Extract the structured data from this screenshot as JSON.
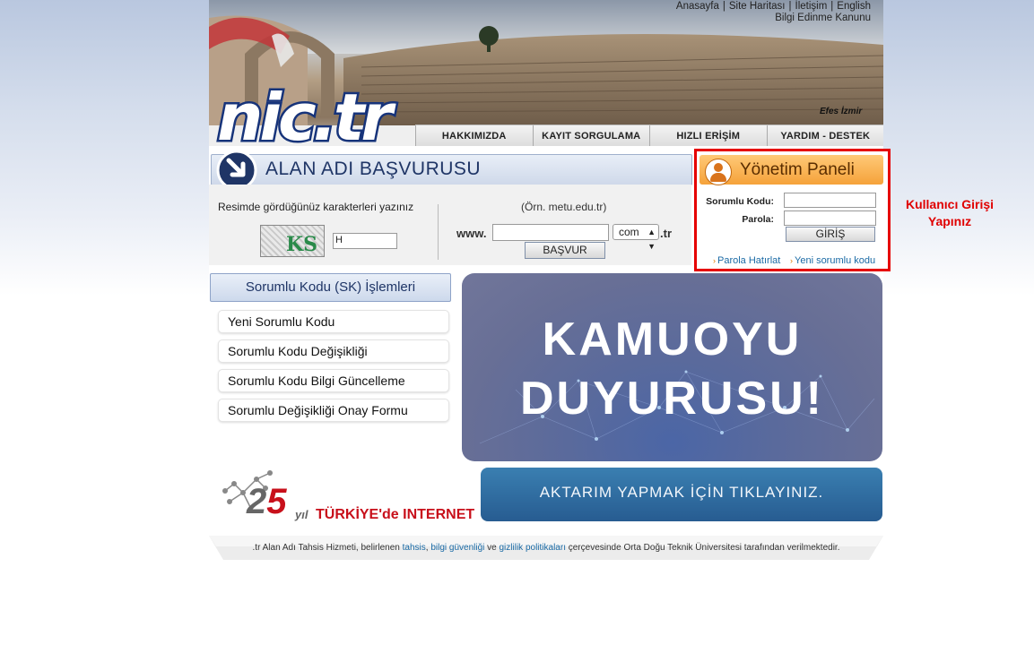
{
  "header": {
    "top_links": [
      "Anasayfa",
      "Site Haritası",
      "İletişim",
      "English"
    ],
    "top_link2": "Bilgi Edinme Kanunu",
    "photo_caption": "Efes İzmir",
    "logo_text": "nic.tr",
    "nav": [
      "HAKKIMIZDA",
      "KAYIT SORGULAMA",
      "HIZLI ERİŞİM",
      "YARDIM - DESTEK"
    ]
  },
  "application": {
    "title": "ALAN ADI BAŞVURUSU",
    "captcha_label": "Resimde gördüğünüz karakterleri yazınız",
    "captcha_text": "KS",
    "captcha_value": "H",
    "example": "(Örn. metu.edu.tr)",
    "www_label": "www.",
    "domain_value": "",
    "tld_selected": "com",
    "tld_suffix": ".tr",
    "submit_label": "BAŞVUR"
  },
  "admin_panel": {
    "title": "Yönetim Paneli",
    "code_label": "Sorumlu Kodu:",
    "password_label": "Parola:",
    "login_label": "GİRİŞ",
    "forgot_link": "Parola Hatırlat",
    "new_code_link": "Yeni sorumlu kodu"
  },
  "annotation": {
    "line1": "Kullanıcı Girişi",
    "line2": "Yapınız"
  },
  "sk_menu": {
    "title": "Sorumlu Kodu (SK) İşlemleri",
    "items": [
      "Yeni Sorumlu Kodu",
      "Sorumlu Kodu Değişikliği",
      "Sorumlu Kodu Bilgi Güncelleme",
      "Sorumlu Değişikliği Onay Formu"
    ]
  },
  "announcement": {
    "line1": "KAMUOYU",
    "line2": "DUYURUSU!"
  },
  "anniversary": {
    "number_2": "2",
    "number_5": "5",
    "yil": "yıl",
    "text": "TÜRKİYE'de INTERNET"
  },
  "transfer_banner": {
    "text": "AKTARIM YAPMAK İÇİN TIKLAYINIZ."
  },
  "footer": {
    "before": ".tr Alan Adı Tahsis Hizmeti, belirlenen ",
    "link1": "tahsis",
    "sep1": ", ",
    "link2": "bilgi güvenliği",
    "sep2": " ve ",
    "link3": "gizlilik politikaları",
    "after": " çerçevesinde Orta Doğu Teknik Üniversitesi tarafından verilmektedir."
  },
  "colors": {
    "highlight": "#e60000",
    "link": "#1a6aa5",
    "panel_orange": "#f5a23a",
    "brand_blue": "#1f3566"
  }
}
